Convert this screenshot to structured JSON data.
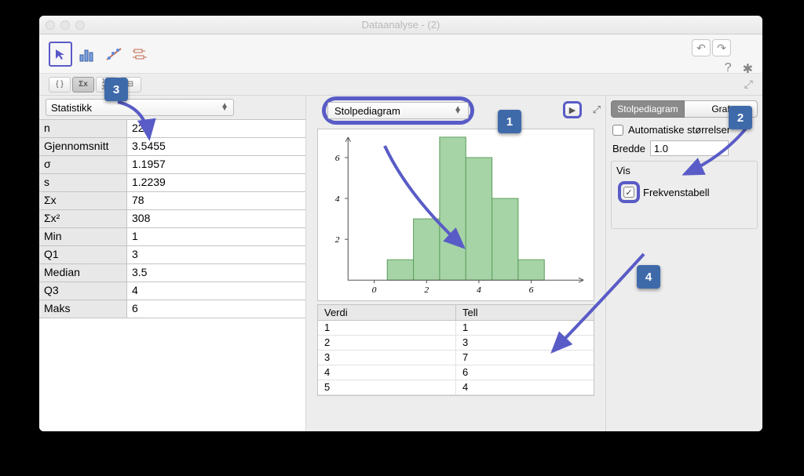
{
  "window": {
    "title": "Dataanalyse - (2)"
  },
  "left": {
    "dropdown": "Statistikk",
    "stats": [
      {
        "label": "n",
        "value": "22"
      },
      {
        "label": "Gjennomsnitt",
        "value": "3.5455"
      },
      {
        "label": "σ",
        "value": "1.1957"
      },
      {
        "label": "s",
        "value": "1.2239"
      },
      {
        "label": "Σx",
        "value": "78"
      },
      {
        "label": "Σx²",
        "value": "308"
      },
      {
        "label": "Min",
        "value": "1"
      },
      {
        "label": "Q1",
        "value": "3"
      },
      {
        "label": "Median",
        "value": "3.5"
      },
      {
        "label": "Q3",
        "value": "4"
      },
      {
        "label": "Maks",
        "value": "6"
      }
    ]
  },
  "mid": {
    "dropdown": "Stolpediagram",
    "freq_headers": [
      "Verdi",
      "Tell"
    ],
    "freq_rows": [
      [
        "1",
        "1"
      ],
      [
        "2",
        "3"
      ],
      [
        "3",
        "7"
      ],
      [
        "4",
        "6"
      ],
      [
        "5",
        "4"
      ]
    ]
  },
  "right": {
    "tab1": "Stolpediagram",
    "tab2": "Graf",
    "auto_sizes": "Automatiske størrelser",
    "width_label": "Bredde",
    "width_value": "1.0",
    "vis_label": "Vis",
    "freq_label": "Frekvenstabell",
    "auto_checked": false,
    "freq_checked": true
  },
  "callouts": {
    "one": "1",
    "two": "2",
    "three": "3",
    "four": "4"
  },
  "chart_data": {
    "type": "bar",
    "title": "",
    "xlabel": "",
    "ylabel": "",
    "categories": [
      1,
      2,
      3,
      4,
      5,
      6
    ],
    "values": [
      1,
      3,
      7,
      6,
      4,
      1
    ],
    "xlim": [
      -1,
      8
    ],
    "ylim": [
      0,
      7
    ],
    "xticks": [
      0,
      2,
      4,
      6
    ],
    "yticks": [
      2,
      4,
      6
    ]
  }
}
